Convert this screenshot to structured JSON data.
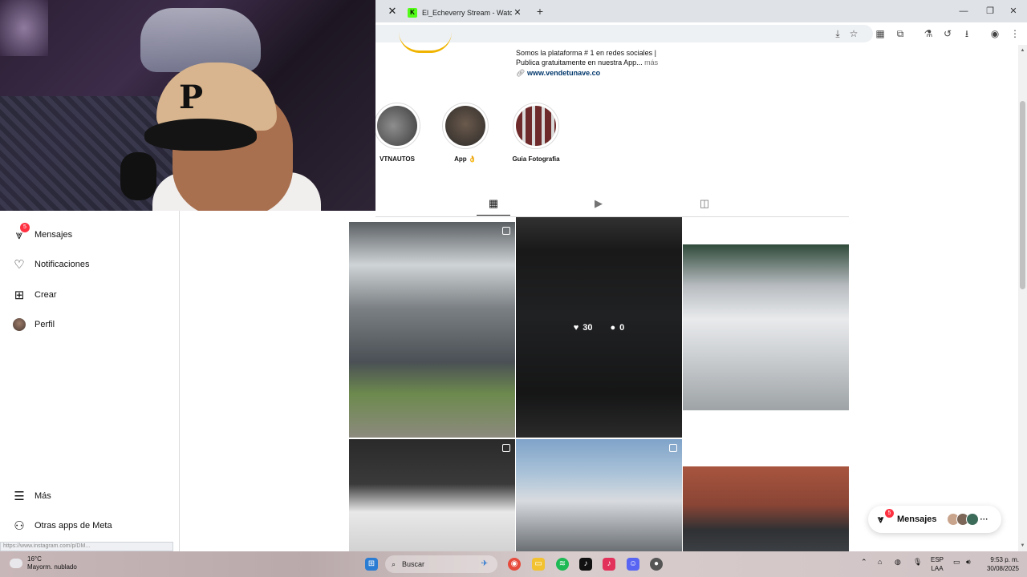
{
  "browser": {
    "tab_title": "El_Echeverry Stream - Watch Li",
    "favicon_letter": "K",
    "prev_tab_close": "✕",
    "tab_close": "✕",
    "new_tab": "+"
  },
  "profile": {
    "bio_line1": "Somos la plataforma # 1 en redes sociales |",
    "bio_line2": "Publica gratuitamente en nuestra App...",
    "bio_more": "más",
    "website": "www.vendetunave.co",
    "highlights": [
      {
        "label": "VTNAUTOS"
      },
      {
        "label": "App 👌"
      },
      {
        "label": "Guia Fotografia"
      }
    ]
  },
  "sidebar": {
    "items": [
      {
        "label": "Mensajes",
        "badge": "5"
      },
      {
        "label": "Notificaciones"
      },
      {
        "label": "Crear"
      },
      {
        "label": "Perfil"
      },
      {
        "label": "Más"
      },
      {
        "label": "Otras apps de Meta"
      }
    ]
  },
  "grid": {
    "hover_post": {
      "likes": "30",
      "comments": "0"
    }
  },
  "messages_pill": {
    "label": "Mensajes",
    "badge": "5",
    "more": "···"
  },
  "status_url": "https://www.instagram.com/p/DM...",
  "taskbar": {
    "temperature": "16°C",
    "weather": "Mayorm. nublado",
    "search_placeholder": "Buscar",
    "lang_top": "ESP",
    "lang_bottom": "LAA",
    "time": "9:53 p. m.",
    "date": "30/08/2025"
  },
  "colors": {
    "badge": "#ff3040",
    "link": "#00376b",
    "kick_green": "#53fc18"
  }
}
